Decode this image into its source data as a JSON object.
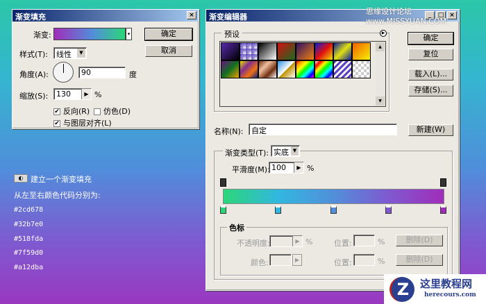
{
  "fill_dialog": {
    "title": "渐变填充",
    "gradient_label": "渐变:",
    "style_label": "样式(T):",
    "style_value": "线性",
    "angle_label": "角度(A):",
    "angle_value": "90",
    "angle_unit": "度",
    "scale_label": "缩放(S):",
    "scale_value": "130",
    "percent": "%",
    "reverse_label": "反向(R)",
    "dither_label": "仿色(D)",
    "align_label": "与图层对齐(L)",
    "reverse_checked": true,
    "dither_checked": false,
    "align_checked": true,
    "ok": "确定",
    "cancel": "取消",
    "close": "×"
  },
  "editor": {
    "title": "渐变编辑器",
    "presets_label": "预设",
    "ok": "确定",
    "reset": "复位",
    "load": "载入(L)...",
    "save": "存储(S)...",
    "name_label": "名称(N):",
    "name_value": "自定",
    "new": "新建(W)",
    "type_label": "渐变类型(T):",
    "type_value": "实底",
    "smooth_label": "平滑度(M):",
    "smooth_value": "100",
    "percent": "%",
    "stops_label": "色标",
    "opacity_label": "不透明度:",
    "color_label": "颜色:",
    "location_label": "位置:",
    "delete": "删除(D)",
    "min": "_",
    "max": "□",
    "close": "×",
    "color_stops": [
      "#2cd678",
      "#32b7e0",
      "#518fda",
      "#7f59d0",
      "#a12dba"
    ]
  },
  "notes": {
    "step": "建立一个渐变填充",
    "desc": "从左至右颜色代码分别为:",
    "colors": [
      "#2cd678",
      "#32b7e0",
      "#518fda",
      "#7f59d0",
      "#a12dba"
    ]
  },
  "watermark": {
    "text": "思缘设计论坛 www.MISSYUAN.COM"
  },
  "logo": {
    "name": "这里教程网",
    "url": "herecours.com"
  }
}
